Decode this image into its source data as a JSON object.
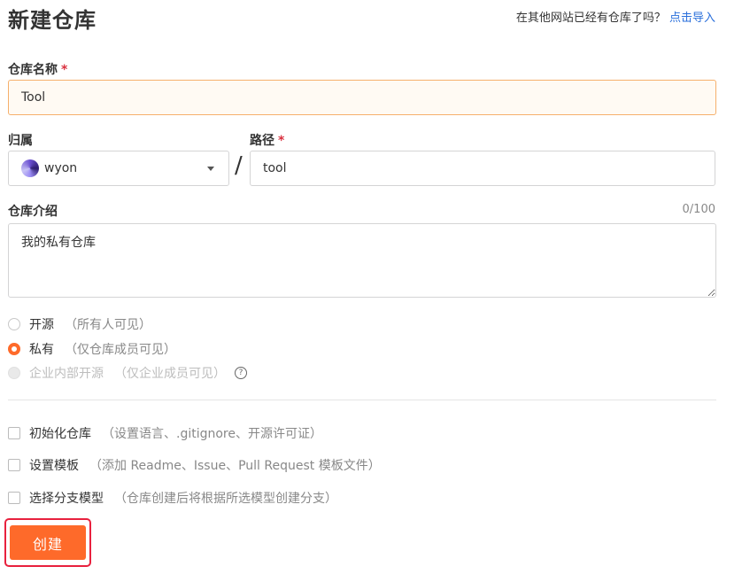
{
  "page": {
    "title": "新建仓库",
    "import_prompt": "在其他网站已经有仓库了吗？",
    "import_link": "点击导入"
  },
  "repo_name": {
    "label": "仓库名称",
    "required_mark": "*",
    "value": "Tool"
  },
  "owner": {
    "label": "归属",
    "selected": "wyon"
  },
  "path": {
    "label": "路径",
    "required_mark": "*",
    "separator": "/",
    "value": "tool"
  },
  "description": {
    "label": "仓库介绍",
    "counter": "0/100",
    "value": "我的私有仓库"
  },
  "visibility": {
    "options": [
      {
        "label": "开源",
        "hint": "（所有人可见）",
        "checked": false,
        "disabled": false
      },
      {
        "label": "私有",
        "hint": "（仅仓库成员可见）",
        "checked": true,
        "disabled": false
      },
      {
        "label": "企业内部开源",
        "hint": "（仅企业成员可见）",
        "checked": false,
        "disabled": true
      }
    ],
    "help_icon": "question-circle-icon"
  },
  "options": [
    {
      "label": "初始化仓库",
      "hint": "（设置语言、.gitignore、开源许可证）",
      "checked": false
    },
    {
      "label": "设置模板",
      "hint": "（添加 Readme、Issue、Pull Request 模板文件）",
      "checked": false
    },
    {
      "label": "选择分支模型",
      "hint": "（仓库创建后将根据所选模型创建分支）",
      "checked": false
    }
  ],
  "submit": {
    "label": "创建"
  },
  "colors": {
    "accent": "#fe6a2a",
    "link": "#2a6fdb",
    "required": "#d9303e",
    "highlight": "#e8213e"
  }
}
